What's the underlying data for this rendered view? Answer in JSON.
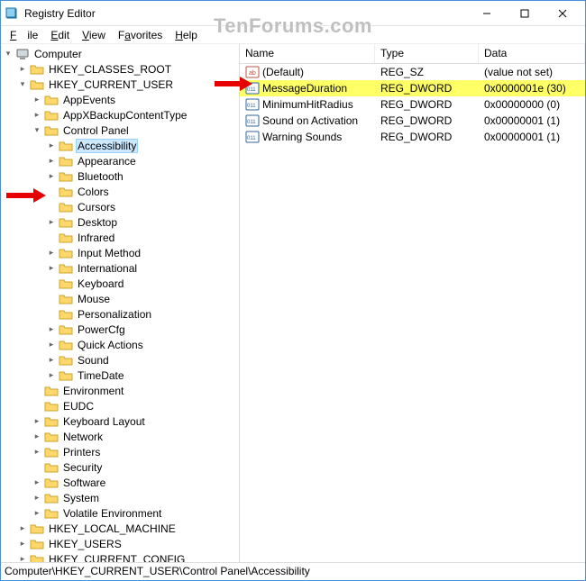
{
  "window": {
    "title": "Registry Editor",
    "watermark": "TenForums.com"
  },
  "menu": {
    "file": "File",
    "edit": "Edit",
    "view": "View",
    "favorites": "Favorites",
    "help": "Help"
  },
  "tree": {
    "root": "Computer",
    "hives": {
      "hkcr": "HKEY_CLASSES_ROOT",
      "hkcu": "HKEY_CURRENT_USER",
      "hklm": "HKEY_LOCAL_MACHINE",
      "hku": "HKEY_USERS",
      "hkcc": "HKEY_CURRENT_CONFIG"
    },
    "hkcu_children": {
      "appevents": "AppEvents",
      "appx": "AppXBackupContentType",
      "cp": "Control Panel",
      "env": "Environment",
      "eudc": "EUDC",
      "kbl": "Keyboard Layout",
      "net": "Network",
      "prn": "Printers",
      "sec": "Security",
      "sw": "Software",
      "sys": "System",
      "vol": "Volatile Environment"
    },
    "cp_children": {
      "access": "Accessibility",
      "appear": "Appearance",
      "bt": "Bluetooth",
      "colors": "Colors",
      "cursors": "Cursors",
      "desktop": "Desktop",
      "infra": "Infrared",
      "input": "Input Method",
      "intl": "International",
      "keyb": "Keyboard",
      "mouse": "Mouse",
      "pers": "Personalization",
      "pwr": "PowerCfg",
      "qa": "Quick Actions",
      "sound": "Sound",
      "td": "TimeDate"
    }
  },
  "list": {
    "headers": {
      "name": "Name",
      "type": "Type",
      "data": "Data"
    },
    "rows": [
      {
        "name": "(Default)",
        "type": "REG_SZ",
        "data": "(value not set)",
        "icon": "sz",
        "highlight": false
      },
      {
        "name": "MessageDuration",
        "type": "REG_DWORD",
        "data": "0x0000001e (30)",
        "icon": "dw",
        "highlight": true
      },
      {
        "name": "MinimumHitRadius",
        "type": "REG_DWORD",
        "data": "0x00000000 (0)",
        "icon": "dw",
        "highlight": false
      },
      {
        "name": "Sound on Activation",
        "type": "REG_DWORD",
        "data": "0x00000001 (1)",
        "icon": "dw",
        "highlight": false
      },
      {
        "name": "Warning Sounds",
        "type": "REG_DWORD",
        "data": "0x00000001 (1)",
        "icon": "dw",
        "highlight": false
      }
    ]
  },
  "statusbar": "Computer\\HKEY_CURRENT_USER\\Control Panel\\Accessibility"
}
